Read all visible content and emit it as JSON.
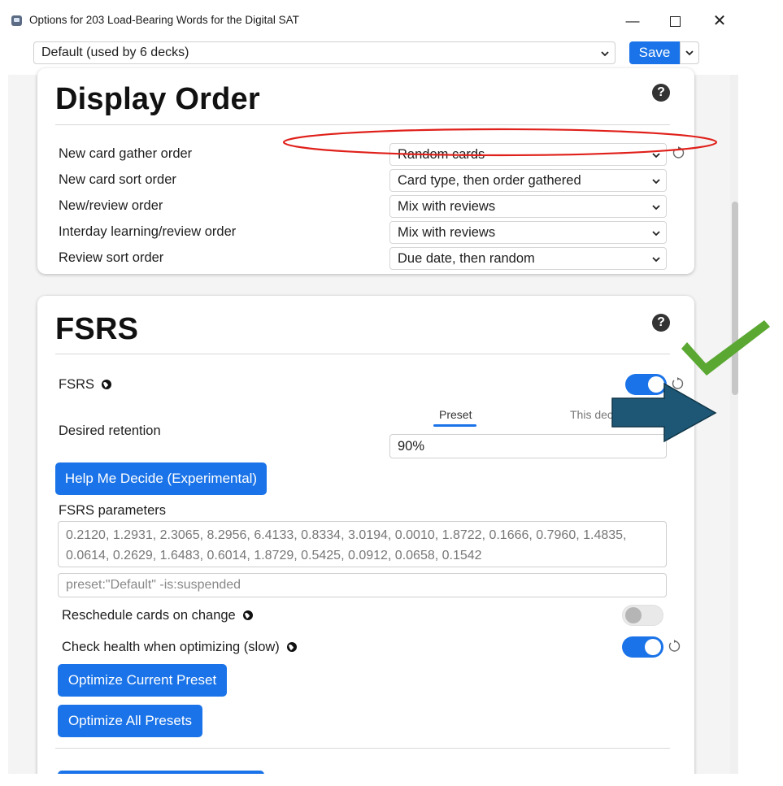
{
  "window": {
    "title": "Options for 203 Load-Bearing Words for the Digital SAT",
    "minimize": "—",
    "close": "✕"
  },
  "toolbar": {
    "preset_value": "Default (used by 6 decks)",
    "save_label": "Save"
  },
  "display_order": {
    "title": "Display Order",
    "help": "?",
    "rows": [
      {
        "label": "New card gather order",
        "value": "Random cards"
      },
      {
        "label": "New card sort order",
        "value": "Card type, then order gathered"
      },
      {
        "label": "New/review order",
        "value": "Mix with reviews"
      },
      {
        "label": "Interday learning/review order",
        "value": "Mix with reviews"
      },
      {
        "label": "Review sort order",
        "value": "Due date, then random"
      }
    ]
  },
  "fsrs": {
    "title": "FSRS",
    "help": "?",
    "toggle_label": "FSRS",
    "toggle_on": true,
    "tab_preset": "Preset",
    "tab_deck": "This deck",
    "desired_retention_label": "Desired retention",
    "desired_retention_value": "90%",
    "help_button": "Help Me Decide (Experimental)",
    "params_label": "FSRS parameters",
    "params_value": "0.2120, 1.2931, 2.3065, 8.2956, 6.4133, 0.8334, 3.0194, 0.0010, 1.8722, 0.1666, 0.7960, 1.4835, 0.0614, 0.2629, 1.6483, 0.6014, 1.8729, 0.5425, 0.0912, 0.0658, 0.1542",
    "search_value": "preset:\"Default\" -is:suspended",
    "reschedule_label": "Reschedule cards on change",
    "reschedule_on": false,
    "health_label": "Check health when optimizing (slow)",
    "health_on": true,
    "optimize_current": "Optimize Current Preset",
    "optimize_all": "Optimize All Presets"
  },
  "annotations": {
    "ellipse_color": "#e0201a",
    "check_color": "#5aa832",
    "arrow_color": "#1e5775"
  },
  "colors": {
    "accent": "#1a73e8",
    "card_bg": "#ffffff",
    "page_bg": "#f4f4f4"
  }
}
